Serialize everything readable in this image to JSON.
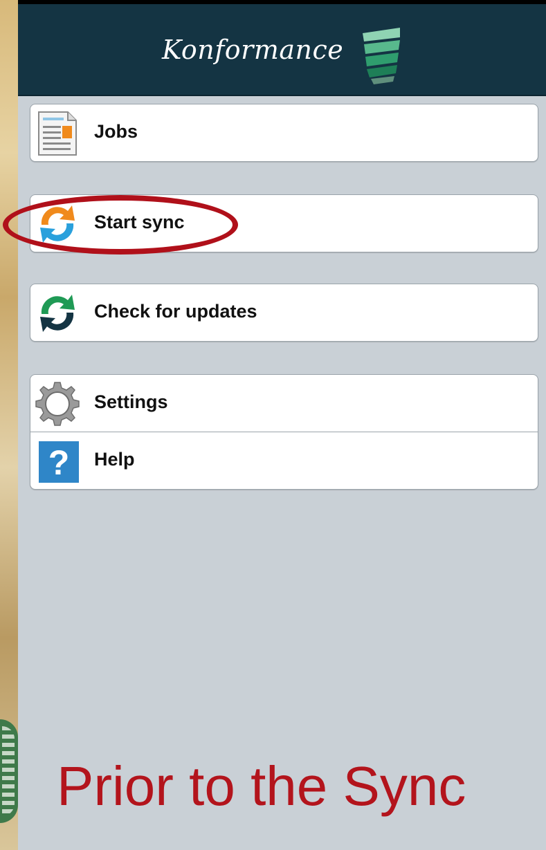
{
  "header": {
    "brand": "Konformance",
    "logo_icon": "stacked-bars-logo",
    "background": "#143443"
  },
  "menu": {
    "jobs": {
      "label": "Jobs",
      "icon": "document-icon"
    },
    "start_sync": {
      "label": "Start sync",
      "icon": "sync-icon"
    },
    "check_updates": {
      "label": "Check for updates",
      "icon": "refresh-icon"
    },
    "settings": {
      "label": "Settings",
      "icon": "gear-icon"
    },
    "help": {
      "label": "Help",
      "icon": "question-icon"
    }
  },
  "caption": "Prior to the Sync",
  "colors": {
    "accent_red": "#b3141c",
    "sync_orange": "#f08a1c",
    "sync_blue": "#2aa0dc",
    "update_green": "#1f9a55",
    "update_dark": "#143443",
    "help_blue": "#2f86c8"
  }
}
